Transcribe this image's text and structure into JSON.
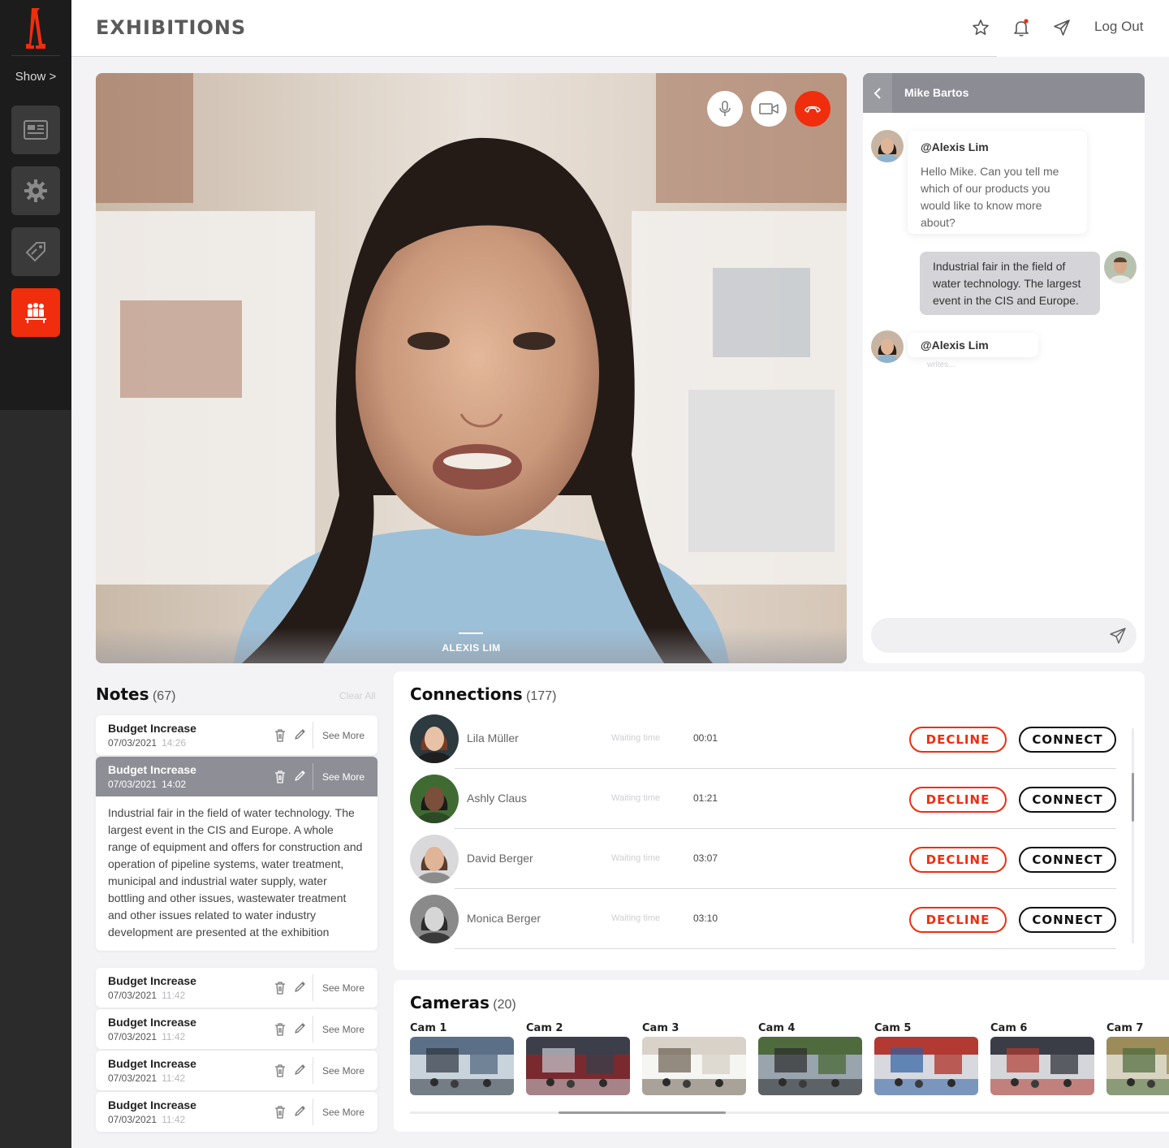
{
  "sidebar": {
    "show_label": "Show >",
    "items": [
      {
        "icon": "news-icon",
        "active": false
      },
      {
        "icon": "gear-icon",
        "active": false
      },
      {
        "icon": "tag-icon",
        "active": false
      },
      {
        "icon": "people-icon",
        "active": true
      }
    ]
  },
  "header": {
    "title": "EXHIBITIONS",
    "logout_label": "Log Out"
  },
  "video": {
    "caller_name": "ALEXIS LIM"
  },
  "chat": {
    "contact_name": "Mike Bartos",
    "messages": [
      {
        "author": "@Alexis Lim",
        "text": "Hello Mike. Can you tell me which of our products you would like to know more about?"
      },
      {
        "text": "Industrial fair in the field of water technology. The largest event in the CIS and Europe."
      }
    ],
    "typing_author": "@Alexis Lim",
    "typing_label": "writes...",
    "input_placeholder": ""
  },
  "notes": {
    "title": "Notes",
    "count": "(67)",
    "clear_label": "Clear All",
    "see_more_label": "See More",
    "items": [
      {
        "title": "Budget Increase",
        "date": "07/03/2021",
        "time": "14:26"
      },
      {
        "title": "Budget Increase",
        "date": "07/03/2021",
        "time": "14:02",
        "body": "Industrial fair in the field of water technology. The largest event in the CIS and Europe. A whole range of equipment and offers for construction and operation of pipeline systems, water treatment, municipal and industrial water supply, water bottling and other issues, wastewater treatment and other issues related to water industry development are presented at the exhibition"
      },
      {
        "title": "Budget Increase",
        "date": "07/03/2021",
        "time": "11:42"
      },
      {
        "title": "Budget Increase",
        "date": "07/03/2021",
        "time": "11:42"
      },
      {
        "title": "Budget Increase",
        "date": "07/03/2021",
        "time": "11:42"
      },
      {
        "title": "Budget Increase",
        "date": "07/03/2021",
        "time": "11:42"
      }
    ]
  },
  "connections": {
    "title": "Connections",
    "count": "(177)",
    "wait_label": "Waiting time",
    "decline_label": "DECLINE",
    "connect_label": "CONNECT",
    "rows": [
      {
        "name": "Lila Müller",
        "wait": "00:01"
      },
      {
        "name": "Ashly Claus",
        "wait": "01:21"
      },
      {
        "name": "David Berger",
        "wait": "03:07"
      },
      {
        "name": "Monica Berger",
        "wait": "03:10"
      }
    ]
  },
  "cameras": {
    "title": "Cameras",
    "count": "(20)",
    "items": [
      {
        "label": "Cam 1"
      },
      {
        "label": "Cam 2"
      },
      {
        "label": "Cam 3"
      },
      {
        "label": "Cam 4"
      },
      {
        "label": "Cam 5"
      },
      {
        "label": "Cam 6"
      },
      {
        "label": "Cam 7"
      }
    ]
  },
  "colors": {
    "accent": "#f02d0c",
    "sidebar": "#1c1c1c",
    "panel_header": "#8c8c94"
  }
}
